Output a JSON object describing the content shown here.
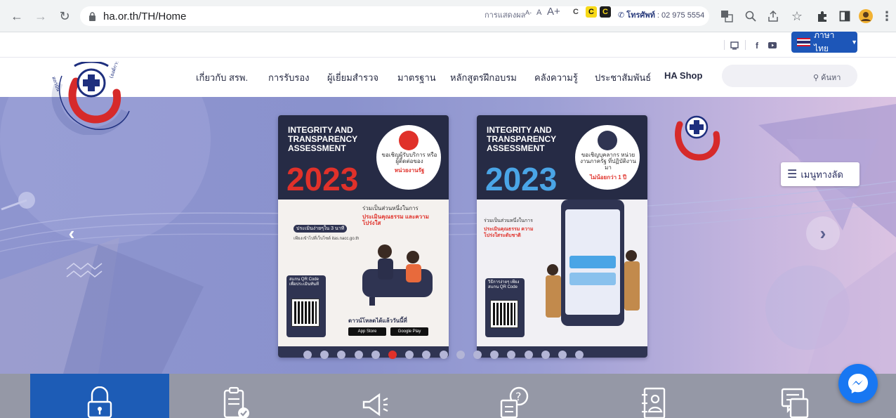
{
  "browser": {
    "url": "ha.or.th/TH/Home"
  },
  "utility_bar": {
    "display_label": "การแสดงผล",
    "font_small": "A-",
    "font_normal": "A",
    "font_large": "A+",
    "contrast_options": [
      "C",
      "C",
      "C"
    ],
    "phone_label": "โทรศัพท์",
    "phone_number": ": 02 975 5554",
    "language": "ภาษาไทย"
  },
  "nav": {
    "items": [
      "เกี่ยวกับ สรพ.",
      "การรับรอง",
      "ผู้เยี่ยมสำรวจ",
      "มาตรฐาน",
      "หลักสูตรฝึกอบรม",
      "คลังความรู้",
      "ประชาสัมพันธ์",
      "HA Shop"
    ],
    "search_label": "ค้นหา"
  },
  "slider": {
    "posters": [
      {
        "title_line1": "INTEGRITY AND",
        "title_line2": "TRANSPARENCY",
        "title_line3": "ASSESSMENT",
        "year": "2023",
        "bubble_text": "ขอเชิญผู้รับบริการ หรือผู้ติดต่อของ",
        "bubble_highlight": "หน่วยงานรัฐ",
        "mid_text": "ร่วมเป็นส่วนหนึ่งในการ",
        "mid_highlight": "ประเมินคุณธรรม และความโปร่งใส",
        "step_title": "ประเมินง่ายๆใน 3 นาที",
        "step1": "เพียงเข้าไปที่เว็บไซต์ itas.nacc.go.th",
        "scan_text": "สแกน QR Code เพื่อประเมินทันที",
        "download_text": "ดาวน์โหลดได้แล้ววันนี้ที่",
        "app_store": "App Store",
        "google_play": "Google Play"
      },
      {
        "title_line1": "INTEGRITY AND",
        "title_line2": "TRANSPARENCY",
        "title_line3": "ASSESSMENT",
        "year": "2023",
        "bubble_text": "ขอเชิญบุคลากร หน่วยงานภาครัฐ ที่ปฏิบัติงานมา",
        "bubble_highlight": "ไม่น้อยกว่า 1 ปี",
        "mid_text": "ร่วมเป็นส่วนหนึ่งในการ",
        "mid_highlight": "ประเมินคุณธรรม ความโปร่งใสระดับชาติ",
        "scan_text": "วิธีการง่ายๆ เพียง สแกน QR Code"
      }
    ],
    "dot_count": 17,
    "active_dot": 5,
    "shortcut_label": "เมนูทางลัด"
  },
  "colors": {
    "brand_blue": "#1d56b8",
    "active_dot": "#e0312a",
    "tile_active": "#1d5cb6",
    "messenger": "#1877f2"
  },
  "icons": {
    "tiles": [
      "lock-icon",
      "clipboard-check-icon",
      "megaphone-icon",
      "faq-icon",
      "book-person-icon",
      "chat-document-icon"
    ]
  }
}
